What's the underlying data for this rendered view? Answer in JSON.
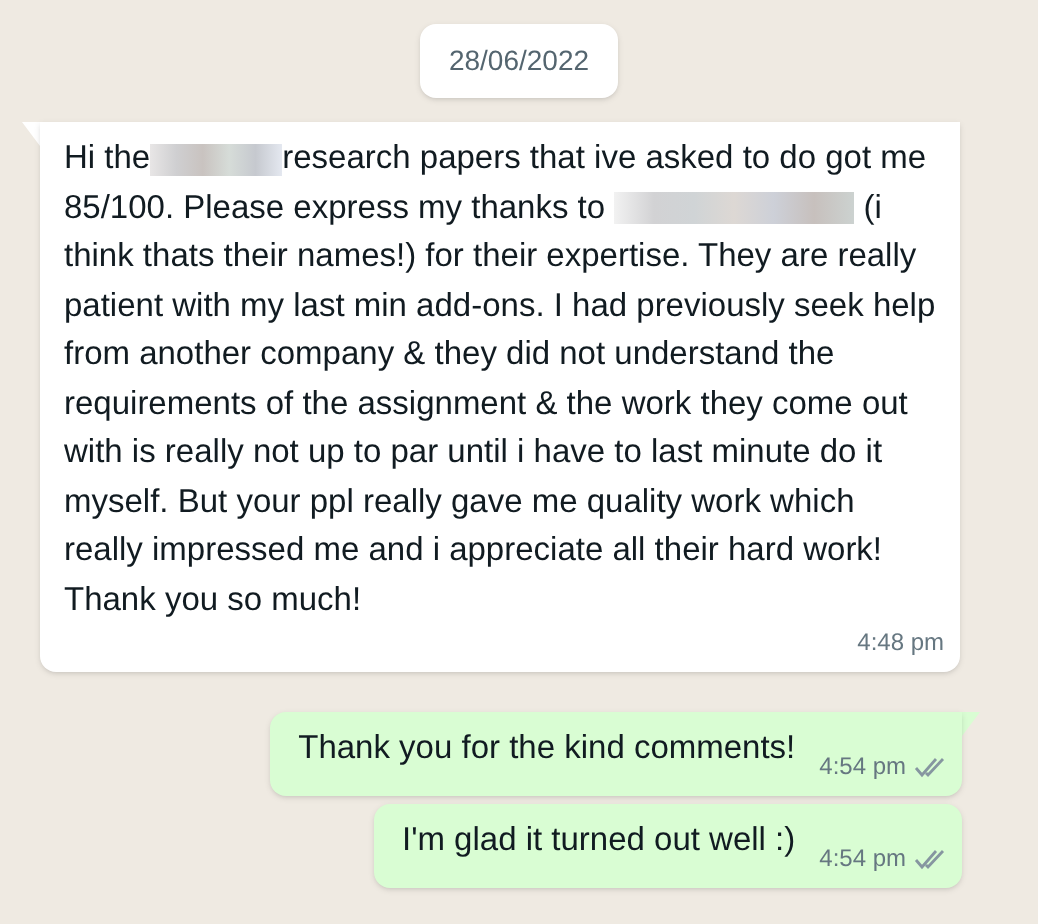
{
  "date_chip": "28/06/2022",
  "messages": [
    {
      "kind": "received",
      "tail": true,
      "parts": [
        {
          "kind": "text",
          "text": "Hi the"
        },
        {
          "kind": "redacted"
        },
        {
          "kind": "text",
          "text": "research papers that ive asked to do got me 85/100. Please express my thanks to "
        },
        {
          "kind": "redacted"
        },
        {
          "kind": "text",
          "text": " (i think thats their names!) for their expertise. They are really patient with my last min add-ons. I had previously seek help from another company & they did not understand the requirements of the assignment & the work they come out with is really not up to par until i have to last minute do it myself. But your ppl really gave me quality work which really impressed me and i appreciate all their hard work! Thank you so much!"
        }
      ],
      "time": "4:48 pm"
    },
    {
      "kind": "sent",
      "parts": [
        {
          "kind": "text",
          "text": "Thank you for the kind comments!"
        }
      ],
      "time": "4:54 pm",
      "read": false,
      "tail": true
    },
    {
      "kind": "sent",
      "parts": [
        {
          "kind": "text",
          "text": "I'm glad it turned out well :)"
        }
      ],
      "time": "4:54 pm",
      "read": false,
      "tail": false
    }
  ]
}
